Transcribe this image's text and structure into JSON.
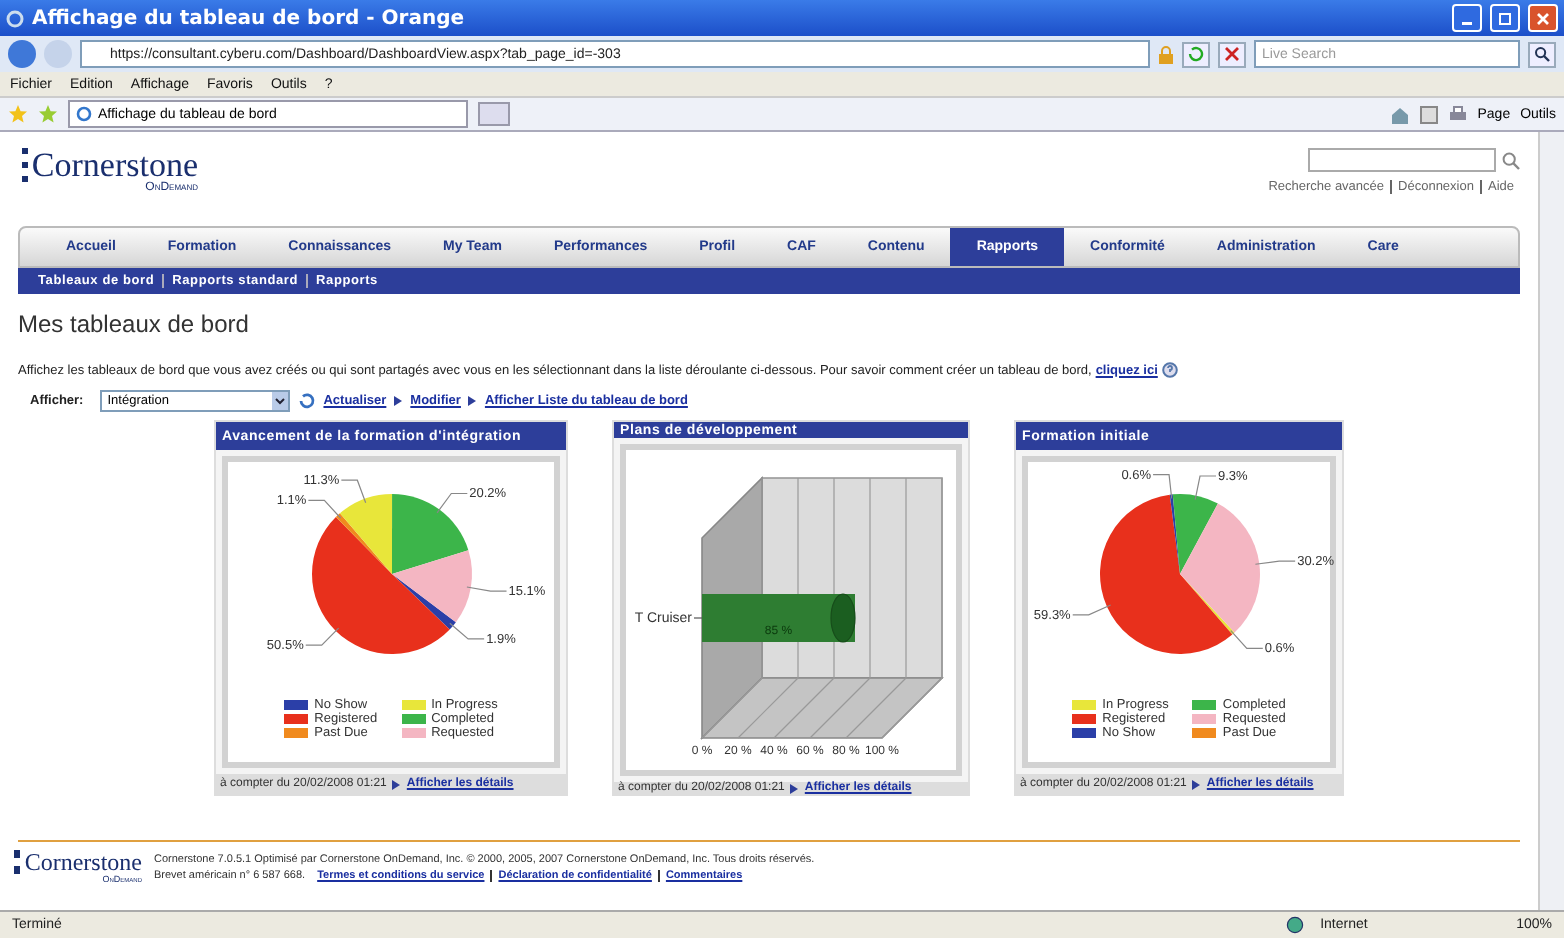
{
  "browser": {
    "title": "Affichage du tableau de bord - Orange",
    "url": "https://consultant.cyberu.com/Dashboard/DashboardView.aspx?tab_page_id=-303",
    "search_placeholder": "Live Search",
    "menu": [
      "Fichier",
      "Edition",
      "Affichage",
      "Favoris",
      "Outils",
      "?"
    ],
    "tab": "Affichage du tableau de bord",
    "tools": [
      "Page",
      "Outils"
    ],
    "status": "Terminé",
    "zone": "Internet",
    "zoom": "100%"
  },
  "header": {
    "logo": "Cornerstone",
    "logo_sub": "OnDemand",
    "links": [
      "Recherche avancée",
      "Déconnexion",
      "Aide"
    ]
  },
  "nav": [
    {
      "label": "Accueil",
      "selected": false
    },
    {
      "label": "Formation",
      "selected": false
    },
    {
      "label": "Connaissances",
      "selected": false
    },
    {
      "label": "My Team",
      "selected": false
    },
    {
      "label": "Performances",
      "selected": false
    },
    {
      "label": "Profil",
      "selected": false
    },
    {
      "label": "CAF",
      "selected": false
    },
    {
      "label": "Contenu",
      "selected": false
    },
    {
      "label": "Rapports",
      "selected": true
    },
    {
      "label": "Conformité",
      "selected": false
    },
    {
      "label": "Administration",
      "selected": false
    },
    {
      "label": "Care",
      "selected": false
    }
  ],
  "subnav": [
    "Tableaux de bord",
    "Rapports standard",
    "Rapports"
  ],
  "heading": "Mes tableaux de bord",
  "intro": "Affichez les tableaux de bord que vous avez créés ou qui sont partagés avec vous en les sélectionnant dans la liste déroulante ci-dessous. Pour savoir comment créer un tableau de bord,",
  "intro_link": "cliquez ici",
  "filter": {
    "label": "Afficher:",
    "value": "Intégration",
    "actions": [
      "Actualiser",
      "Modifier",
      "Afficher Liste du tableau de bord"
    ]
  },
  "cards": [
    {
      "title": "Avancement de la formation d'intégration",
      "date": "à compter du 20/02/2008 01:21",
      "link": "Afficher les détails",
      "chart_data": {
        "type": "pie",
        "categories": [
          "No Show",
          "Registered",
          "Past Due",
          "In Progress",
          "Completed",
          "Requested"
        ],
        "series": [
          {
            "colors": [
              "#2b3fa8",
              "#e8301c",
              "#f08a1e",
              "#e8e63a",
              "#3cb54a",
              "#f4b6c2"
            ],
            "values": [
              1.9,
              50.5,
              1.1,
              11.3,
              20.2,
              15.1
            ]
          }
        ],
        "value_labels": [
          "1.9%",
          "50.5%",
          "1.1%",
          "11.3%",
          "20.2%",
          "15.1%"
        ]
      }
    },
    {
      "title": "Plans de développement",
      "date": "à compter du 20/02/2008 01:21",
      "link": "Afficher les détails",
      "chart_data": {
        "type": "bar",
        "orientation": "horizontal",
        "categories": [
          "T Cruiser"
        ],
        "series": [
          {
            "color": "#2e7d32",
            "values": [
              85
            ]
          }
        ],
        "value_labels": [
          "85 %"
        ],
        "xlim": [
          0,
          100
        ],
        "xticks": [
          {
            "value": 0,
            "label": "0 %"
          },
          {
            "value": 20,
            "label": "20 %"
          },
          {
            "value": 40,
            "label": "40 %"
          },
          {
            "value": 60,
            "label": "60 %"
          },
          {
            "value": 80,
            "label": "80 %"
          },
          {
            "value": 100,
            "label": "100 %"
          }
        ]
      }
    },
    {
      "title": "Formation initiale",
      "date": "à compter du 20/02/2008 01:21",
      "link": "Afficher les détails",
      "chart_data": {
        "type": "pie",
        "categories": [
          "In Progress",
          "Registered",
          "No Show",
          "Completed",
          "Requested",
          "Past Due"
        ],
        "series": [
          {
            "colors": [
              "#e8e63a",
              "#e8301c",
              "#2b3fa8",
              "#3cb54a",
              "#f4b6c2",
              "#f08a1e"
            ],
            "values": [
              0.6,
              59.3,
              0.6,
              9.3,
              30.2,
              0
            ]
          }
        ],
        "value_labels": [
          "0.6%",
          "59.3%",
          "0.6%",
          "9.3%",
          "30.2%",
          null
        ]
      }
    }
  ],
  "footer": {
    "logo": "Cornerstone",
    "logo_sub": "OnDemand",
    "line1": "Cornerstone 7.0.5.1 Optimisé par Cornerstone OnDemand, Inc. © 2000, 2005, 2007 Cornerstone OnDemand, Inc. Tous droits réservés.",
    "line2": "Brevet américain n° 6 587 668.",
    "links": [
      "Termes et conditions du service",
      "Déclaration de confidentialité",
      "Commentaires"
    ]
  }
}
